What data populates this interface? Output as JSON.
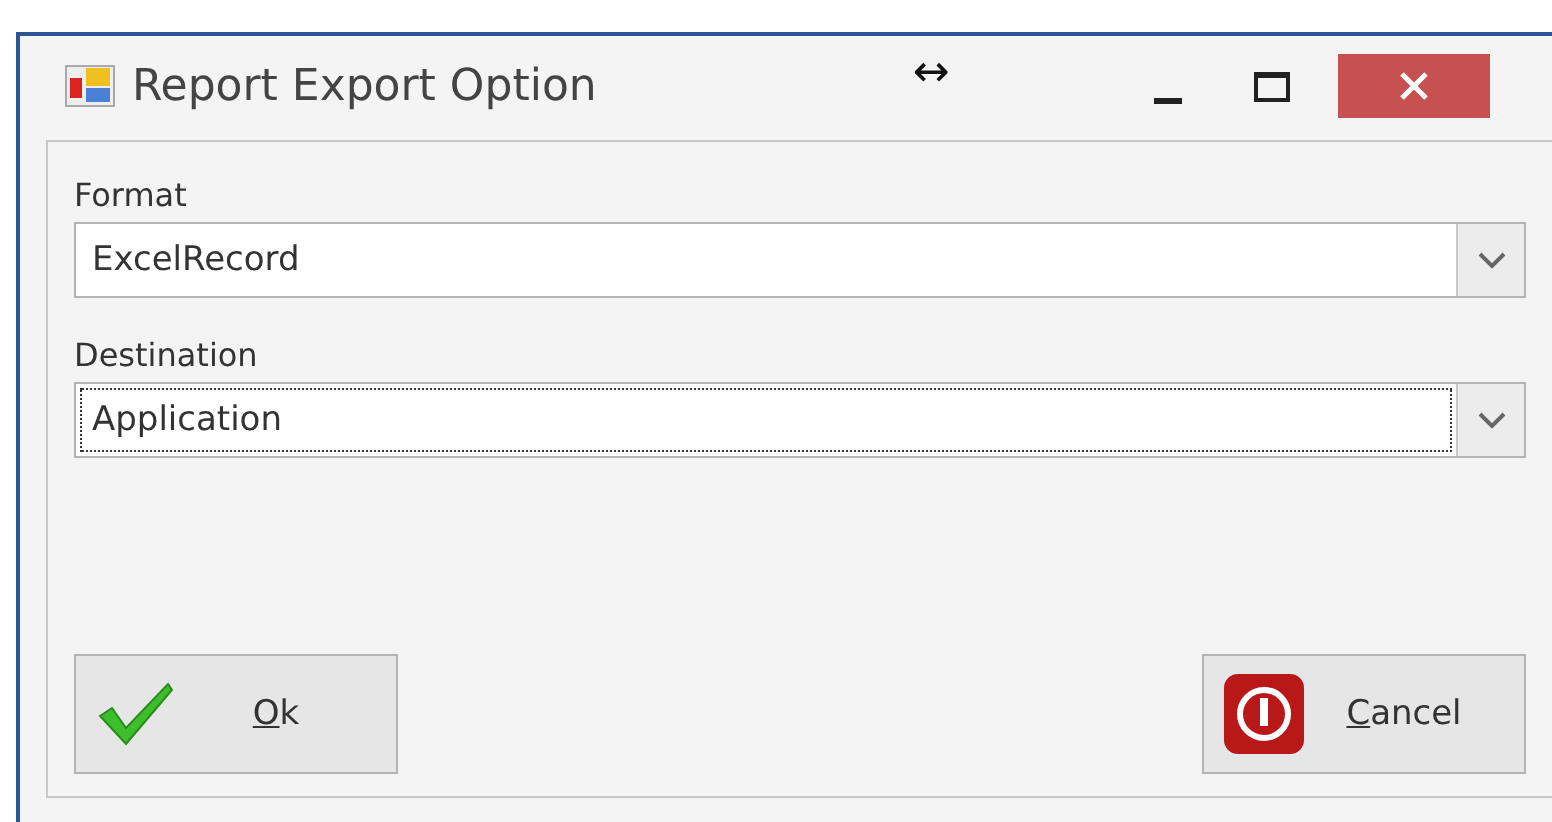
{
  "window": {
    "title": "Report Export Option",
    "resize_glyph": "↔"
  },
  "fields": [
    {
      "label": "Format",
      "value": "ExcelRecord",
      "focused": false
    },
    {
      "label": "Destination",
      "value": "Application",
      "focused": true
    }
  ],
  "buttons": [
    {
      "kind": "ok",
      "mnemonic": "O",
      "rest": "k"
    },
    {
      "kind": "cancel",
      "mnemonic": "C",
      "rest": "ancel"
    }
  ]
}
